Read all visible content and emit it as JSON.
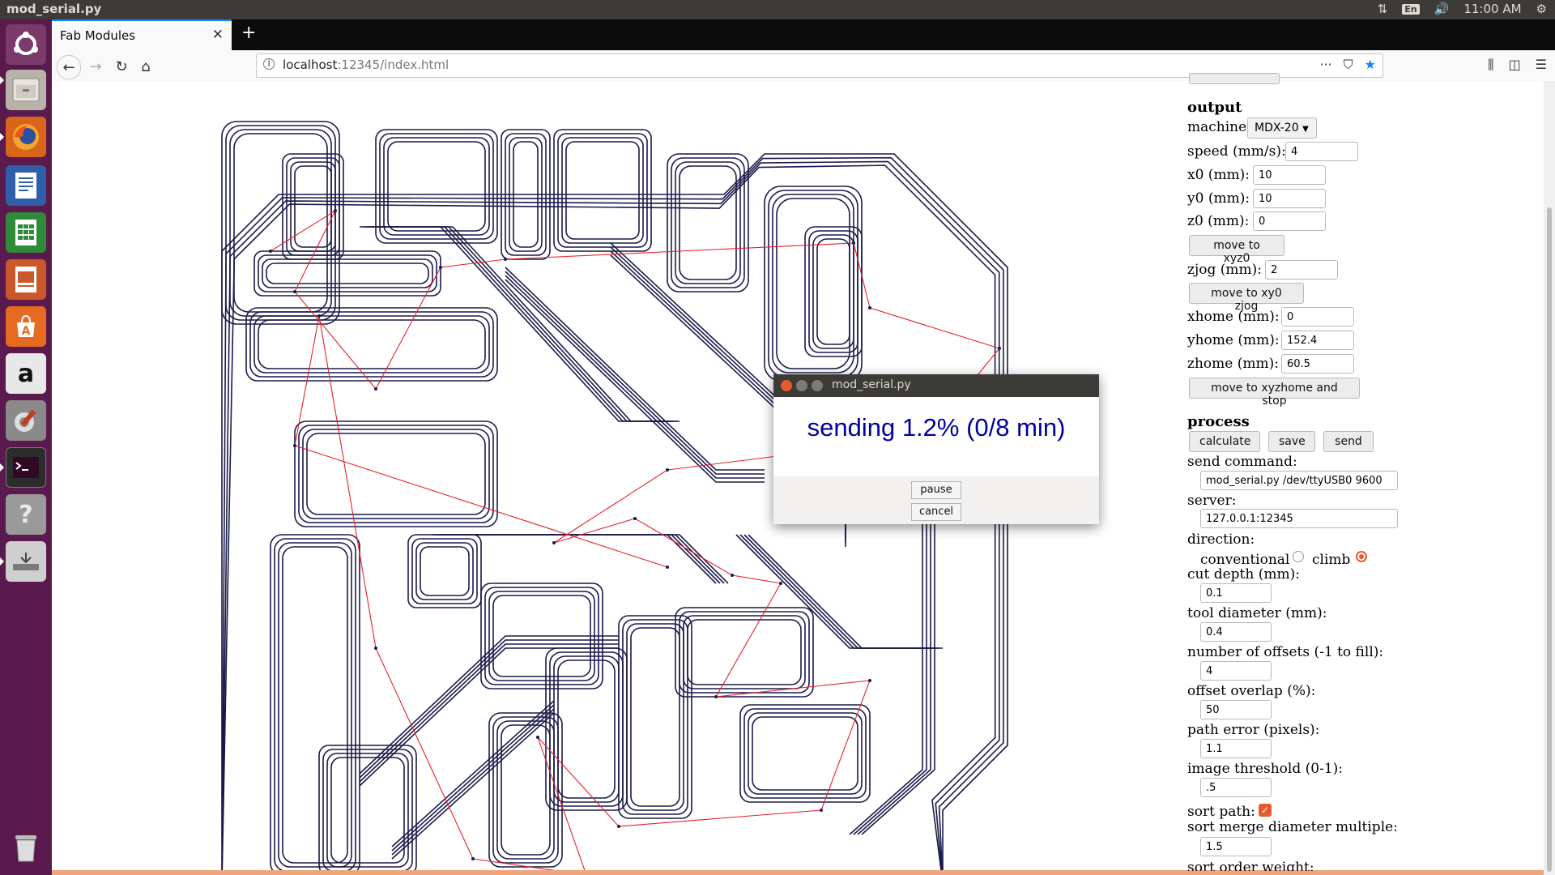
{
  "system": {
    "window_title": "mod_serial.py",
    "keyboard_layout": "En",
    "clock": "11:00 AM",
    "tray_icons": [
      "network-arrows-icon",
      "keyboard-icon",
      "volume-icon",
      "gear-icon"
    ]
  },
  "launcher": {
    "items": [
      "ubuntu-dash-icon",
      "files-icon",
      "firefox-icon",
      "writer-icon",
      "calc-icon",
      "impress-icon",
      "software-center-icon",
      "amazon-icon",
      "settings-icon",
      "terminal-icon",
      "help-icon",
      "mod-installer-icon",
      "trash-icon"
    ],
    "amazon_glyph": "a",
    "help_glyph": "?"
  },
  "browser": {
    "tab_title": "Fab Modules",
    "url_host": "localhost",
    "url_rest": ":12345/index.html"
  },
  "panel": {
    "output_heading": "output",
    "machine_label": "machine",
    "machine_value": "MDX-20",
    "speed_label": "speed (mm/s):",
    "speed_value": "4",
    "x0_label": "x0 (mm):",
    "x0_value": "10",
    "y0_label": "y0 (mm):",
    "y0_value": "10",
    "z0_label": "z0 (mm):",
    "z0_value": "0",
    "move_xyz0": "move to xyz0",
    "zjog_label": "zjog (mm):",
    "zjog_value": "2",
    "move_xy0_zjog": "move to xy0 zjog",
    "xhome_label": "xhome (mm):",
    "xhome_value": "0",
    "yhome_label": "yhome (mm):",
    "yhome_value": "152.4",
    "zhome_label": "zhome (mm):",
    "zhome_value": "60.5",
    "move_home_stop": "move to xyzhome and stop",
    "process_heading": "process",
    "calculate": "calculate",
    "save": "save",
    "send": "send",
    "send_command_label": "send command:",
    "send_command_value": "mod_serial.py /dev/ttyUSB0 9600",
    "server_label": "server:",
    "server_value": "127.0.0.1:12345",
    "direction_label": "direction:",
    "conventional_label": "conventional",
    "climb_label": "climb",
    "direction_selected": "climb",
    "cut_depth_label": "cut depth (mm):",
    "cut_depth_value": "0.1",
    "tool_diameter_label": "tool diameter (mm):",
    "tool_diameter_value": "0.4",
    "offsets_label": "number of offsets (-1 to fill):",
    "offsets_value": "4",
    "overlap_label": "offset overlap (%):",
    "overlap_value": "50",
    "path_error_label": "path error (pixels):",
    "path_error_value": "1.1",
    "threshold_label": "image threshold (0-1):",
    "threshold_value": ".5",
    "sort_path_label": "sort path:",
    "sort_path_checked": true,
    "sort_merge_label": "sort merge diameter multiple:",
    "sort_merge_value": "1.5",
    "sort_order_label": "sort order weight:"
  },
  "dialog": {
    "title": "mod_serial.py",
    "message": "sending 1.2% (0/8 min)",
    "pause": "pause",
    "cancel": "cancel"
  },
  "colors": {
    "toolpath": "#1a1a4a",
    "move_path": "#e8202a",
    "launcher_bg": "#5a1a4e",
    "dialog_text": "#0000a0",
    "accent": "#e9592e"
  }
}
